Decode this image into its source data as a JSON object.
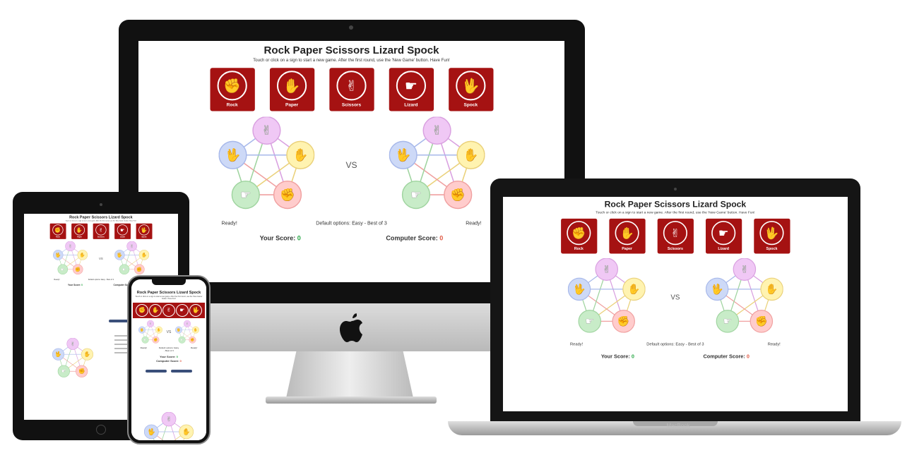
{
  "app": {
    "title": "Rock Paper Scissors Lizard Spock",
    "subtitle": "Touch or click on a sign to start a new game. After the first round, use the 'New Game' button. Have Fun!",
    "signs": [
      {
        "label": "Rock",
        "glyph": "✊"
      },
      {
        "label": "Paper",
        "glyph": "✋"
      },
      {
        "label": "Scissors",
        "glyph": "✌"
      },
      {
        "label": "Lizard",
        "glyph": "☛"
      },
      {
        "label": "Spock",
        "glyph": "🖖"
      }
    ],
    "vs": "VS",
    "player_status": "Ready!",
    "computer_status": "Ready!",
    "default_options": "Default options: Easy - Best of 3",
    "your_score_label": "Your Score:",
    "your_score": "0",
    "computer_score_label": "Computer Score:",
    "computer_score": "0"
  },
  "devices": {
    "laptop_brand": "MacBook"
  },
  "colors": {
    "sign_bg": "#a51212",
    "win": "#28a745",
    "lose": "#e05a44",
    "wheel_rock": "#ffcccc",
    "wheel_paper": "#fff3b0",
    "wheel_scissors": "#f0c8f5",
    "wheel_lizard": "#c8ecc8",
    "wheel_spock": "#cdd9f7"
  }
}
